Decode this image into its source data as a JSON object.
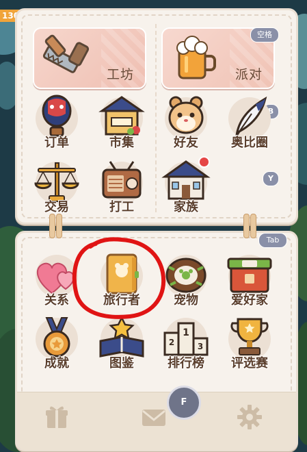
{
  "hud": {
    "level_text": "130"
  },
  "menu": {
    "top_cards": [
      {
        "label": "工坊",
        "icon": "saw-icon"
      },
      {
        "label": "派对",
        "icon": "beer-mug-icon"
      }
    ],
    "keys": {
      "space": "空格",
      "b": "B",
      "y": "Y",
      "tab": "Tab",
      "f": "F"
    },
    "top_grid": [
      {
        "label": "订单",
        "icon": "hot-air-balloon-icon"
      },
      {
        "label": "市集",
        "icon": "market-stall-icon"
      },
      {
        "label": "好友",
        "icon": "hamster-face-icon"
      },
      {
        "label": "奥比圈",
        "icon": "quill-feather-icon"
      },
      {
        "label": "交易",
        "icon": "balance-scale-icon"
      },
      {
        "label": "打工",
        "icon": "radio-icon"
      },
      {
        "label": "家族",
        "icon": "house-icon",
        "badge": "red-dot"
      }
    ],
    "bottom_grid": [
      {
        "label": "关系",
        "icon": "hearts-icon"
      },
      {
        "label": "旅行者",
        "icon": "book-icon",
        "highlighted": true
      },
      {
        "label": "宠物",
        "icon": "pet-nest-icon"
      },
      {
        "label": "爱好家",
        "icon": "hobby-box-icon"
      },
      {
        "label": "成就",
        "icon": "medal-icon"
      },
      {
        "label": "图鉴",
        "icon": "star-book-icon"
      },
      {
        "label": "排行榜",
        "icon": "podium-icon"
      },
      {
        "label": "评选赛",
        "icon": "trophy-icon"
      }
    ],
    "bottom_bar": [
      {
        "icon": "gift-icon"
      },
      {
        "icon": "mail-icon"
      },
      {
        "icon": "gear-icon"
      }
    ],
    "colors": {
      "panel": "#f7f2ec",
      "label_text": "#5a3e2c",
      "key_badge": "#8a90a8",
      "annotation": "#e01414"
    }
  }
}
